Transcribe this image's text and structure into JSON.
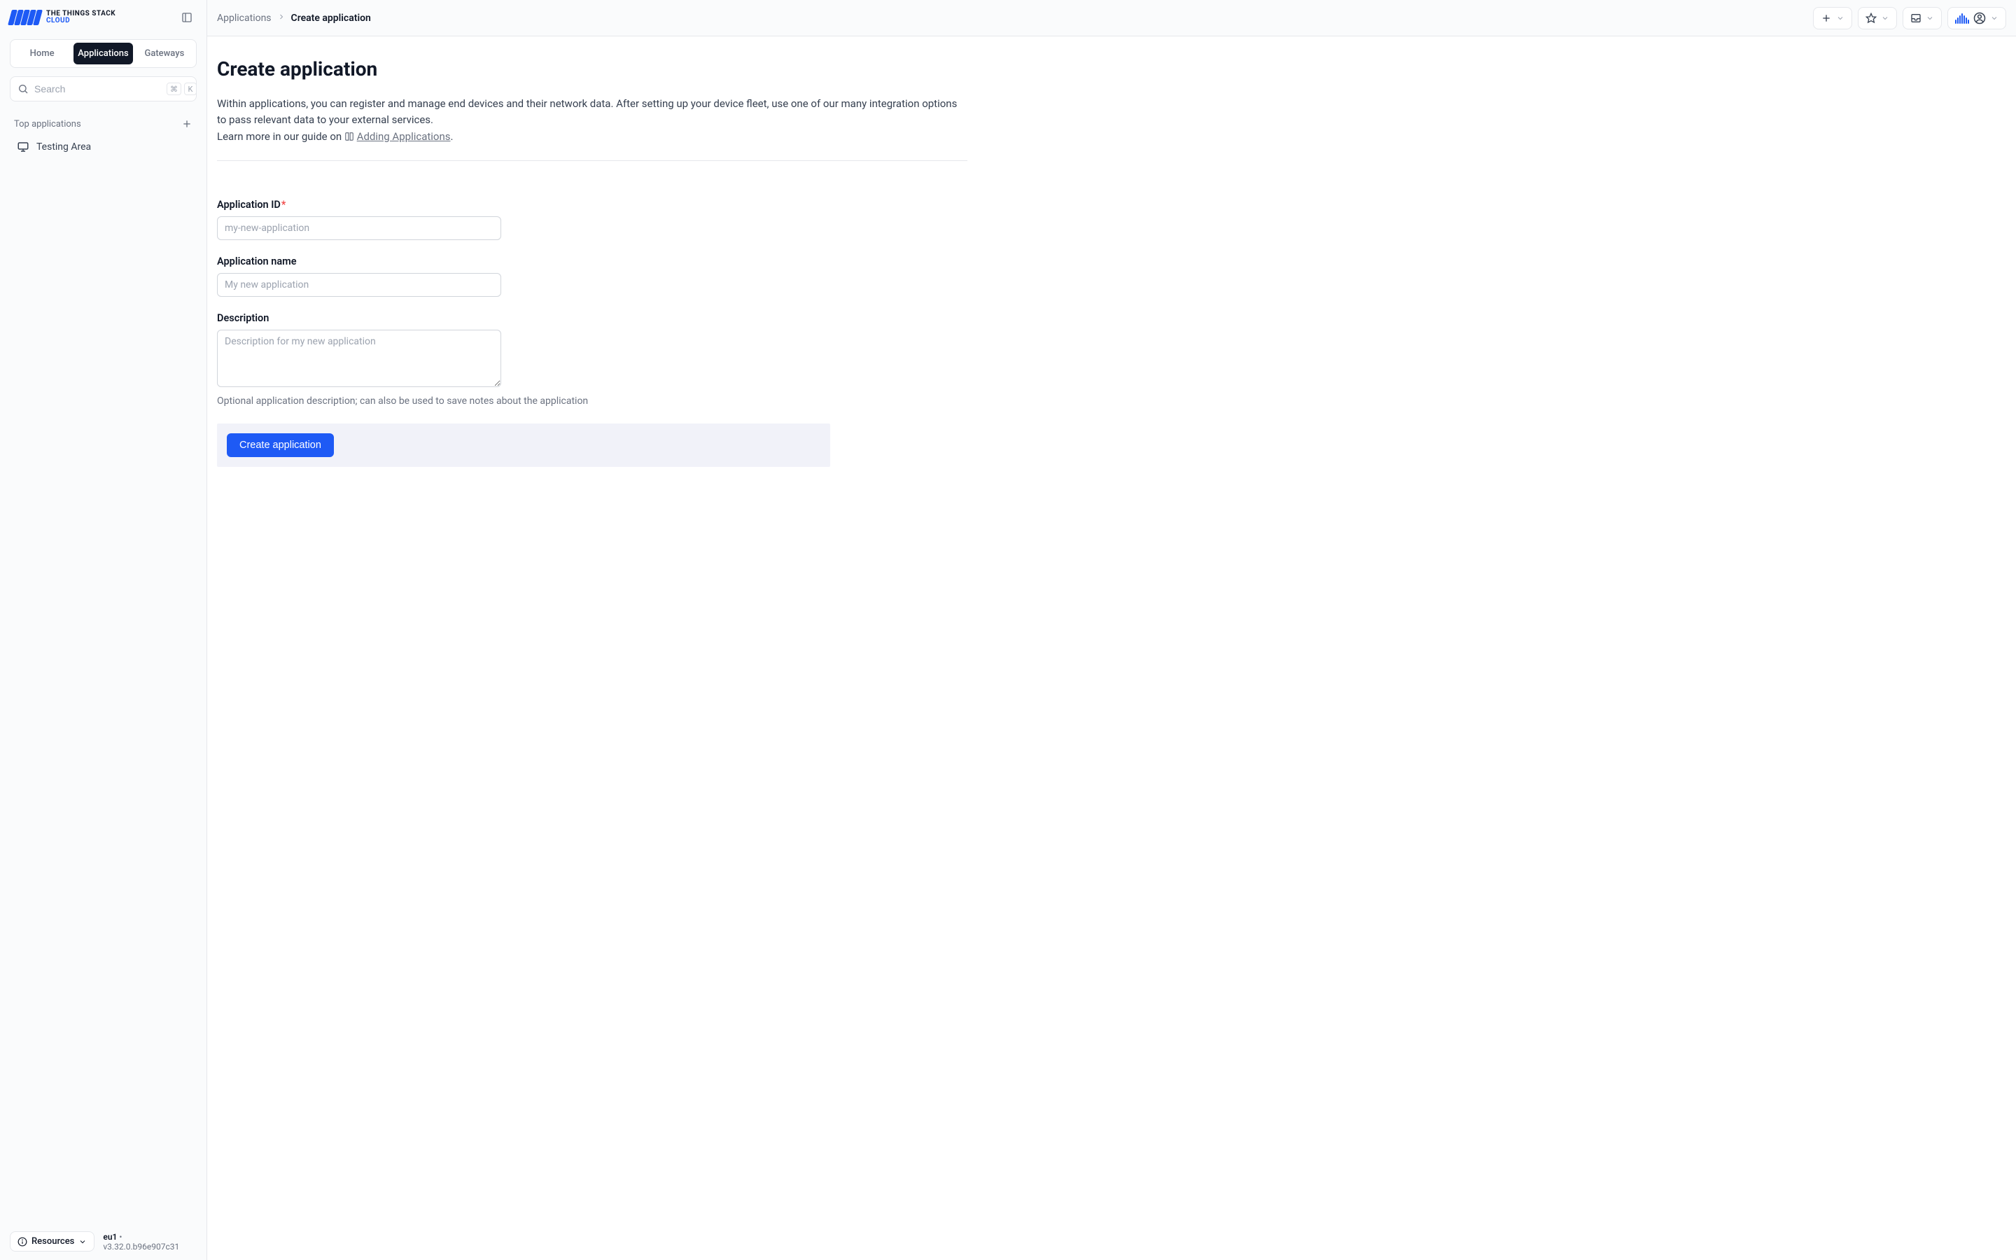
{
  "brand": {
    "title": "THE THINGS STACK",
    "subtitle": "CLOUD"
  },
  "sidebar": {
    "nav": {
      "home": "Home",
      "applications": "Applications",
      "gateways": "Gateways"
    },
    "search": {
      "placeholder": "Search",
      "kbd1": "⌘",
      "kbd2": "K"
    },
    "section": {
      "title": "Top applications"
    },
    "apps": [
      {
        "name": "Testing Area"
      }
    ],
    "footer": {
      "resources": "Resources",
      "cluster": "eu1",
      "sep": " • ",
      "version": "v3.32.0.b96e907c31"
    }
  },
  "breadcrumb": {
    "root": "Applications",
    "current": "Create application"
  },
  "page": {
    "title": "Create application",
    "intro": "Within applications, you can register and manage end devices and their network data. After setting up your device fleet, use one of our many integration options to pass relevant data to your external services.",
    "learn_prefix": "Learn more in our guide on ",
    "learn_link": "Adding Applications",
    "learn_suffix": "."
  },
  "form": {
    "app_id": {
      "label": "Application ID",
      "placeholder": "my-new-application"
    },
    "app_name": {
      "label": "Application name",
      "placeholder": "My new application"
    },
    "description": {
      "label": "Description",
      "placeholder": "Description for my new application",
      "hint": "Optional application description; can also be used to save notes about the application"
    },
    "submit": "Create application"
  }
}
